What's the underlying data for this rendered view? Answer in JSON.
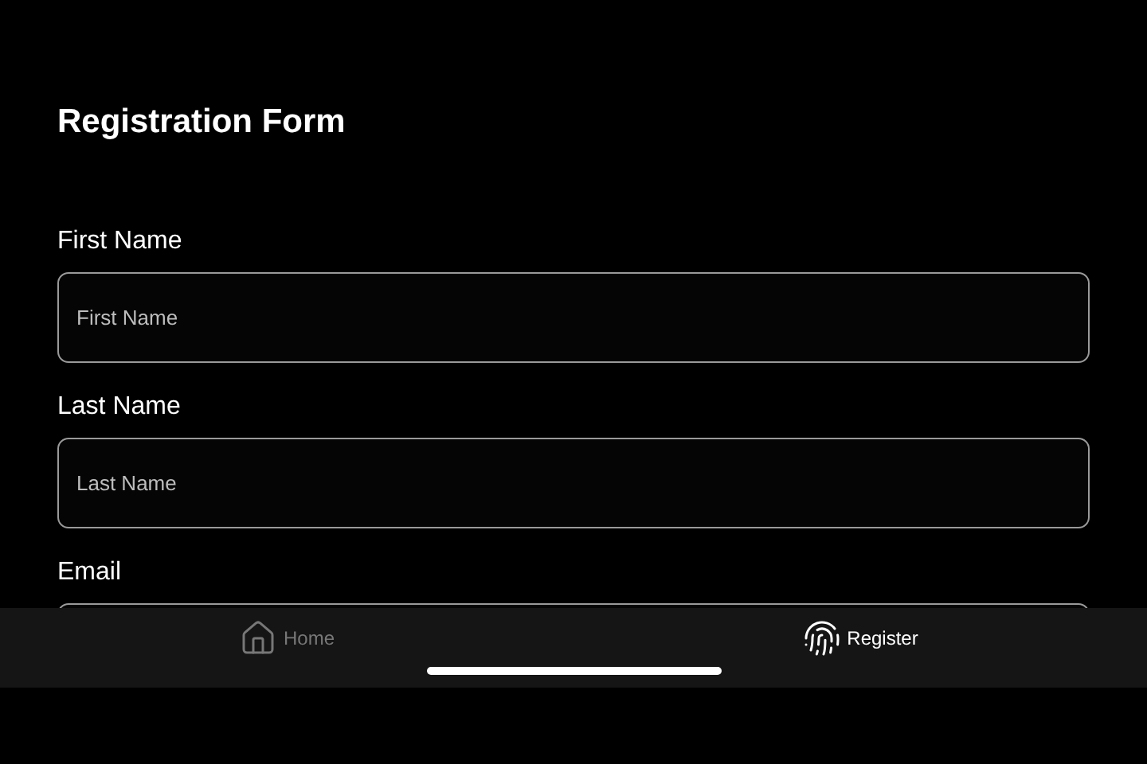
{
  "title": "Registration Form",
  "fields": [
    {
      "label": "First Name",
      "placeholder": "First Name"
    },
    {
      "label": "Last Name",
      "placeholder": "Last Name"
    },
    {
      "label": "Email"
    }
  ],
  "tabs": [
    {
      "label": "Home",
      "kind": "home",
      "selected": false
    },
    {
      "label": "Register",
      "kind": "fingerprint",
      "selected": true
    }
  ]
}
